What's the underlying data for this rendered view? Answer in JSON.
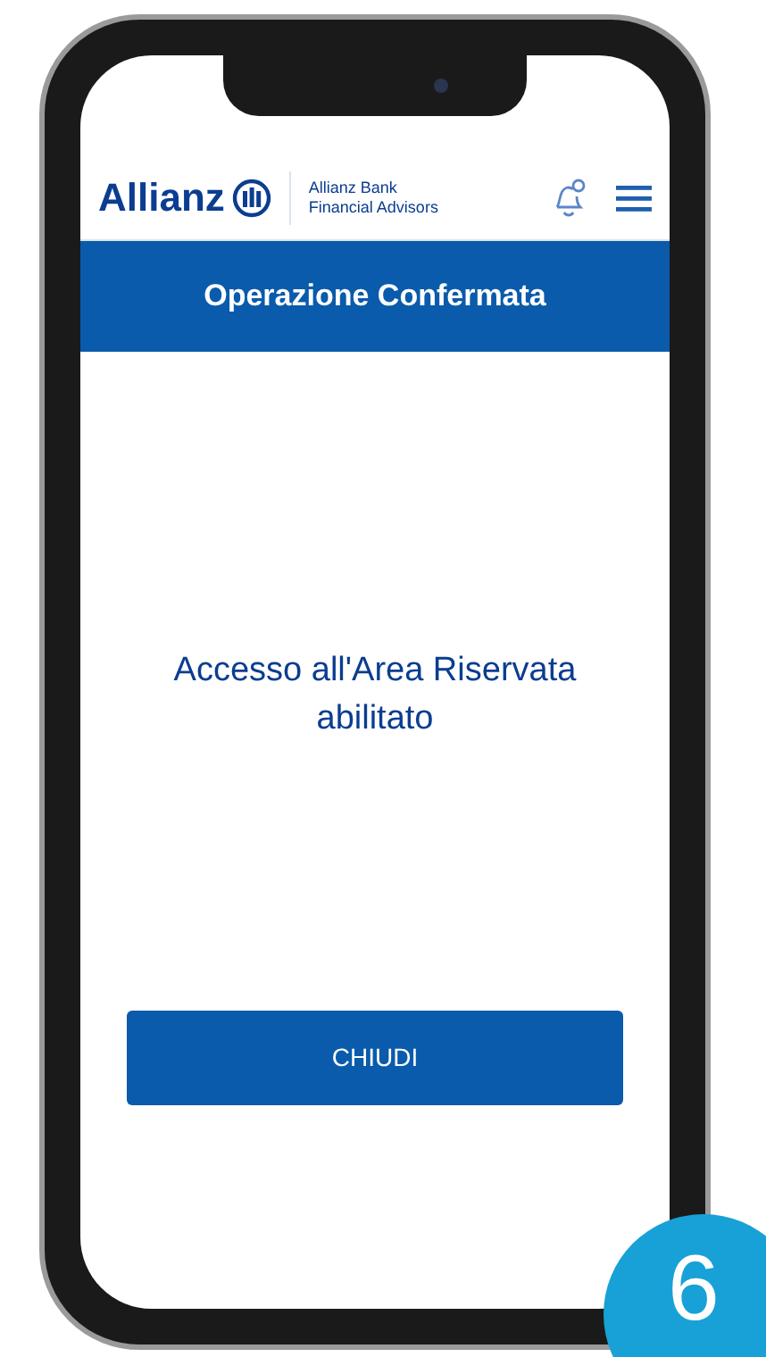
{
  "header": {
    "brand": "Allianz",
    "partner_line_1": "Allianz Bank",
    "partner_line_2": "Financial Advisors"
  },
  "title_bar": {
    "title": "Operazione Confermata"
  },
  "message": "Accesso all'Area Riservata abilitato",
  "button": {
    "label": "CHIUDI"
  },
  "step_badge": "6"
}
